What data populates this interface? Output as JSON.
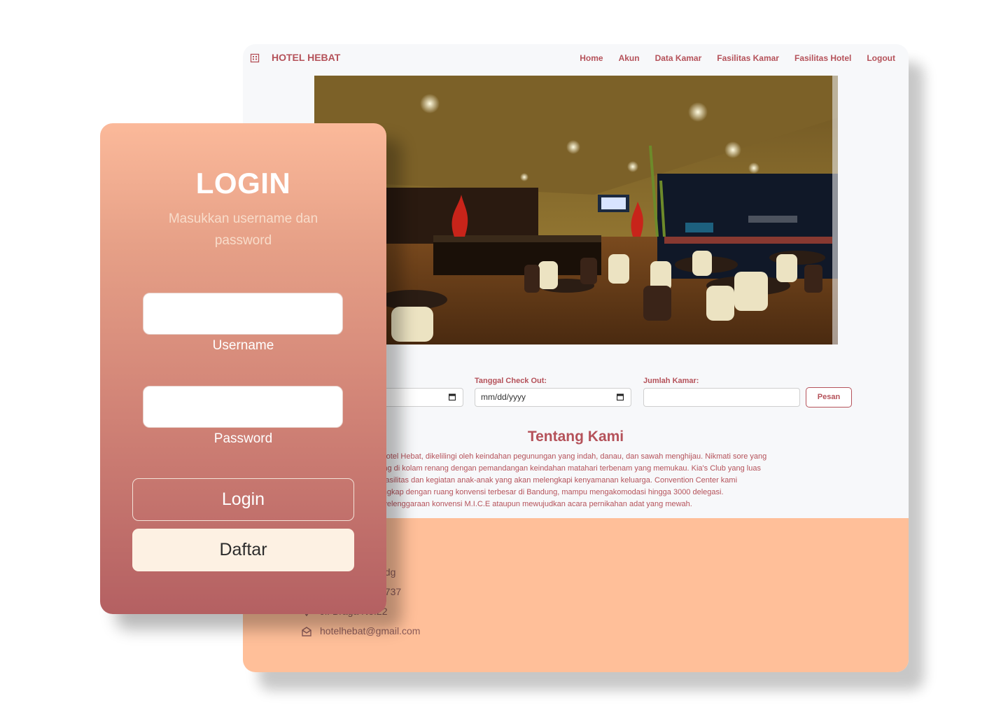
{
  "site": {
    "brand": "HOTEL HEBAT",
    "menu": [
      "Home",
      "Akun",
      "Data Kamar",
      "Fasilitas Kamar",
      "Fasilitas Hotel",
      "Logout"
    ],
    "booking": {
      "checkout_label": "Tanggal Check Out:",
      "date_placeholder": "mm/dd/yyyy",
      "rooms_label": "Jumlah Kamar:",
      "submit_label": "Pesan"
    },
    "about": {
      "title": "Tentang Kami",
      "lines": [
        "ce Hotel Hebat, dikelilingi oleh keindahan pegunungan yang indah, danau, dan sawah menghijau. Nikmati sore yang",
        "enang di kolam renang dengan pemandangan keindahan matahari terbenam yang memukau. Kia's Club yang luas",
        "am fasilitas dan kegiatan anak-anak yang akan melengkapi kenyamanan keluarga. Convention Center kami",
        "n lengkap dengan ruang konvensi terbesar di Bandung, mampu mengakomodasi hingga 3000 delegasi.",
        "penyelenggaraan konvensi M.I.C.E ataupun mewujudkan acara pernikahan adat yang mewah."
      ]
    },
    "footer": {
      "line1": "odg",
      "line2": "8737",
      "address": "Jl. Braga No.22",
      "email": "hotelhebat@gmail.com"
    }
  },
  "login": {
    "title": "LOGIN",
    "subtitle": "Masukkan username dan password",
    "username_label": "Username",
    "password_label": "Password",
    "login_button": "Login",
    "register_button": "Daftar"
  },
  "colors": {
    "accent": "#b5525a",
    "footer_bg": "#ffbf99",
    "daftar_bg": "#fdf1e3"
  }
}
